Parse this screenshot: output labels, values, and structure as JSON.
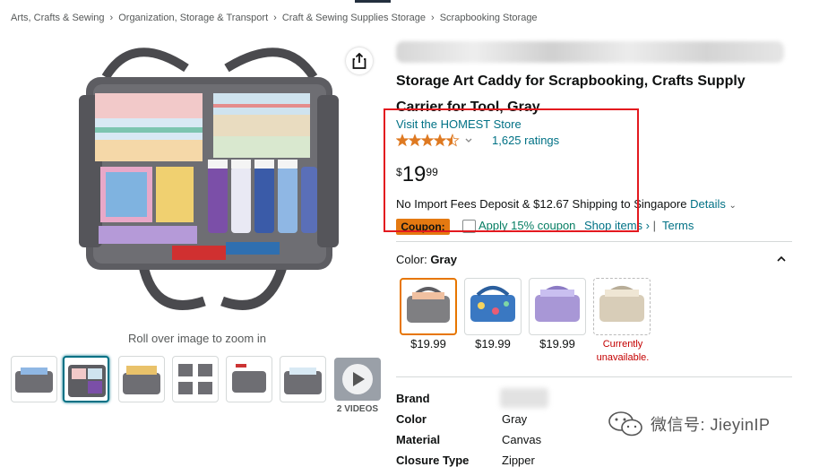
{
  "breadcrumb": [
    "Arts, Crafts & Sewing",
    "Organization, Storage & Transport",
    "Craft & Sewing Supplies Storage",
    "Scrapbooking Storage"
  ],
  "gallery": {
    "zoom_hint": "Roll over image to zoom in",
    "videos_label": "2 VIDEOS"
  },
  "product": {
    "title": "Storage Art Caddy for Scrapbooking, Crafts Supply Carrier for Tool, Gray",
    "store_link": "Visit the HOMEST Store",
    "rating_value": 4.5,
    "ratings_count": "1,625 ratings",
    "price": {
      "currency": "$",
      "whole": "19",
      "fraction": "99"
    },
    "shipping_text": "No Import Fees Deposit & $12.67 Shipping to Singapore",
    "details_link": "Details",
    "coupon": {
      "badge": "Coupon:",
      "text": "Apply 15% coupon",
      "shop_items": "Shop items ›",
      "divider": "|",
      "terms": "Terms"
    }
  },
  "color": {
    "label": "Color:",
    "selected": "Gray",
    "options": [
      {
        "price": "$19.99",
        "color": "#7f7f82"
      },
      {
        "price": "$19.99",
        "color": "#3a78c2"
      },
      {
        "price": "$19.99",
        "color": "#a897d6"
      },
      {
        "line1": "Currently",
        "line2": "unavailable.",
        "color": "#d8cdb8"
      }
    ]
  },
  "specs": [
    {
      "label": "Brand",
      "value": ""
    },
    {
      "label": "Color",
      "value": "Gray"
    },
    {
      "label": "Material",
      "value": "Canvas"
    },
    {
      "label": "Closure Type",
      "value": "Zipper"
    }
  ],
  "watermark": {
    "text": "微信号: JieyinIP"
  },
  "colors": {
    "link": "#007185",
    "coupon_badge": "#e47911",
    "coupon_text": "#067d62",
    "highlight": "#e3191f",
    "unavailable": "#c40000",
    "star": "#de7921"
  }
}
